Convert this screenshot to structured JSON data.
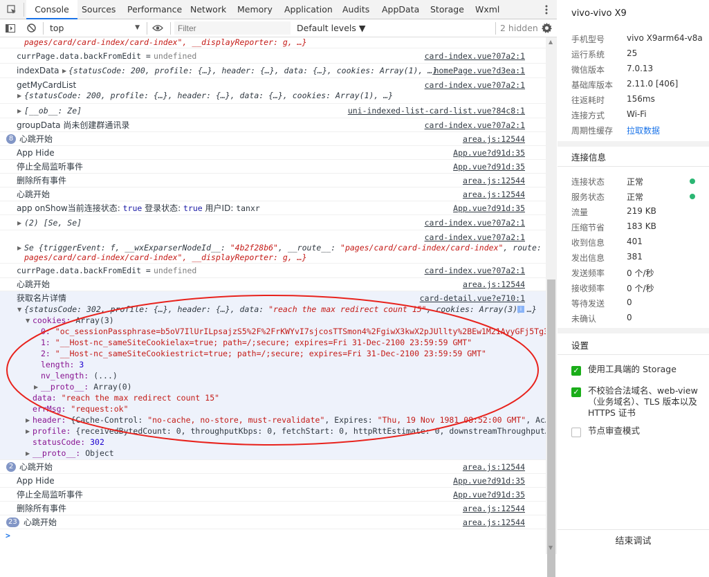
{
  "devtools": {
    "tabs": [
      "Console",
      "Sources",
      "Performance",
      "Network",
      "Memory",
      "Application",
      "Audits",
      "AppData",
      "Storage",
      "Wxml"
    ],
    "filter": {
      "context": "top",
      "placeholder": "Filter",
      "levels": "Default levels ▼",
      "hidden": "2 hidden"
    },
    "icons": {
      "inspect": "inspect-icon",
      "device": "device-icon",
      "more": "more-vertical-icon",
      "sidebar": "sidebar-toggle-icon",
      "clear": "clear-icon",
      "eye": "eye-icon",
      "gear": "gear-icon"
    }
  },
  "log": {
    "r0": {
      "text": "pages/card/card-index/card-index\", __displayReporter: g, …}"
    },
    "r1": {
      "label": "currPage.data.backFromEdit =",
      "value": "undefined",
      "src": "card-index.vue?07a2:1"
    },
    "r2": {
      "label": "indexData",
      "obj": "{statusCode: 200, profile: {…}, header: {…}, data: {…}, cookies: Array(1), …}",
      "src": "homePage.vue?d3ea:1"
    },
    "r3": {
      "label": "getMyCardList",
      "obj": "{statusCode: 200, profile: {…}, header: {…}, data: {…}, cookies: Array(1), …}",
      "src": "card-index.vue?07a2:1"
    },
    "r4": {
      "obj": "[__ob__: Ze]",
      "src": "uni-indexed-list-card-list.vue?84c8:1"
    },
    "r5": {
      "text": "groupData 尚未创建群通讯录",
      "src": "card-index.vue?07a2:1"
    },
    "r6": {
      "badge": "8",
      "text": "心跳开始",
      "src": "area.js:12544"
    },
    "r7": {
      "text": "App Hide",
      "src": "App.vue?d91d:35"
    },
    "r8": {
      "text": "停止全局监听事件",
      "src": "App.vue?d91d:35"
    },
    "r9": {
      "text": "删除所有事件",
      "src": "area.js:12544"
    },
    "r10": {
      "text": "心跳开始",
      "src": "area.js:12544"
    },
    "r11": {
      "a": "app onShow当前连接状态:",
      "b": "true",
      "c": "登录状态:",
      "d": "true",
      "e": "用户ID:",
      "f": "tanxr",
      "src": "App.vue?d91d:35"
    },
    "r12": {
      "obj": "(2) [Se, Se]",
      "src": "card-index.vue?07a2:1"
    },
    "r13": {
      "src": "card-index.vue?07a2:1",
      "l1a": "Se {triggerEvent: f, __wxExparserNodeId__:",
      "l1b": "\"4b2f28b6\"",
      "l1c": ", __route__:",
      "l1d": "\"pages/card/card-index/card-index\"",
      "l1e": ", route: \"",
      "l2": "pages/card/card-index/card-index\", __displayReporter: g, …}"
    },
    "r14": {
      "label": "currPage.data.backFromEdit =",
      "value": "undefined",
      "src": "card-index.vue?07a2:1"
    },
    "r15": {
      "text": "心跳开始",
      "src": "area.js:12544"
    },
    "r16": {
      "title": "获取名片详情",
      "src": "card-detail.vue?e710:1",
      "summary_a": "{statusCode: 302, profile: {…}, header: {…}, data:",
      "summary_b": "\"reach the max redirect count 15\"",
      "summary_c": ", cookies: Array(3), …}",
      "cookies_key": "cookies:",
      "cookies_val": "Array(3)",
      "c0k": "0:",
      "c0v": "\"oc_sessionPassphrase=b5oV7IlUrILpsajzS5%2F%2FrKWYvI7sjcosTTSmon4%2FgiwX3kwX2pJUllty%2BEw1M21AyyGFj5Tg3…",
      "c1k": "1:",
      "c1v": "\"__Host-nc_sameSiteCookielax=true; path=/;secure; expires=Fri 31-Dec-2100 23:59:59 GMT\"",
      "c2k": "2:",
      "c2v": "\"__Host-nc_sameSiteCookiestrict=true; path=/;secure; expires=Fri 31-Dec-2100 23:59:59 GMT\"",
      "len_k": "length:",
      "len_v": "3",
      "nvl_k": "nv_length:",
      "nvl_v": "(...)",
      "proto1_k": "__proto__:",
      "proto1_v": "Array(0)",
      "data_k": "data:",
      "data_v": "\"reach the max redirect count 15\"",
      "err_k": "errMsg:",
      "err_v": "\"request:ok\"",
      "hdr_k": "header:",
      "hdr_a": "{Cache-Control:",
      "hdr_b": "\"no-cache, no-store, must-revalidate\"",
      "hdr_c": ", Expires:",
      "hdr_d": "\"Thu, 19 Nov 1981 08:52:00 GMT\"",
      "hdr_e": ", Ac…",
      "prof_k": "profile:",
      "prof_v": "{receivedBytedCount: 0, throughputKbps: 0, fetchStart: 0, httpRttEstimate: 0, downstreamThroughput…",
      "sc_k": "statusCode:",
      "sc_v": "302",
      "proto2_k": "__proto__:",
      "proto2_v": "Object"
    },
    "r17": {
      "badge": "2",
      "text": "心跳开始",
      "src": "area.js:12544"
    },
    "r18": {
      "text": "App Hide",
      "src": "App.vue?d91d:35"
    },
    "r19": {
      "text": "停止全局监听事件",
      "src": "App.vue?d91d:35"
    },
    "r20": {
      "text": "删除所有事件",
      "src": "area.js:12544"
    },
    "r21": {
      "badge": "23",
      "text": "心跳开始",
      "src": "area.js:12544"
    },
    "prompt": ">"
  },
  "side": {
    "title": "vivo-vivo X9",
    "device": [
      {
        "label": "手机型号",
        "value": "vivo X9arm64-v8a"
      },
      {
        "label": "运行系统",
        "value": "25"
      },
      {
        "label": "微信版本",
        "value": "7.0.13"
      },
      {
        "label": "基础库版本",
        "value": "2.11.0 [406]"
      },
      {
        "label": "往返耗时",
        "value": "156ms"
      },
      {
        "label": "连接方式",
        "value": "Wi-Fi"
      },
      {
        "label": "周期性缓存",
        "value": "拉取数据"
      }
    ],
    "conn_title": "连接信息",
    "conn": [
      {
        "label": "连接状态",
        "value": "正常"
      },
      {
        "label": "服务状态",
        "value": "正常"
      },
      {
        "label": "流量",
        "value": "219 KB"
      },
      {
        "label": "压缩节省",
        "value": "183 KB"
      },
      {
        "label": "收到信息",
        "value": "401"
      },
      {
        "label": "发出信息",
        "value": "381"
      },
      {
        "label": "发送频率",
        "value": "0 个/秒"
      },
      {
        "label": "接收频率",
        "value": "0 个/秒"
      },
      {
        "label": "等待发送",
        "value": "0"
      },
      {
        "label": "未确认",
        "value": "0"
      }
    ],
    "settings_title": "设置",
    "settings": [
      {
        "label": "使用工具端的 Storage",
        "checked": true
      },
      {
        "label": "不校验合法域名、web-view（业务域名）、TLS 版本以及 HTTPS 证书",
        "checked": true
      },
      {
        "label": "节点审查模式",
        "checked": false
      }
    ],
    "end_button": "结束调试",
    "colors": {
      "ok_dot": "#2bb673",
      "link": "#1a73e8",
      "checkbox": "#1aad19",
      "annotation": "#e8221c"
    }
  }
}
